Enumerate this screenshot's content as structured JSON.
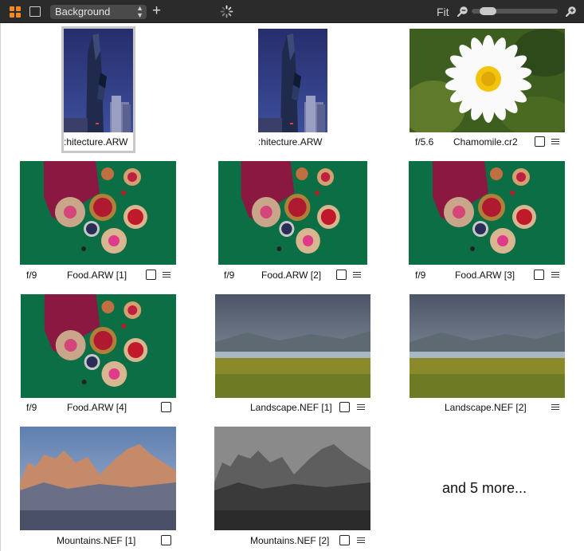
{
  "toolbar": {
    "preset_value": "Background",
    "fit_label": "Fit",
    "zoom_level": 0.12
  },
  "images": [
    {
      "name": ":hitecture.ARW",
      "aperture": "",
      "has_checkbox": false,
      "has_note": false,
      "selected": true,
      "thumb": "tower"
    },
    {
      "name": ":hitecture.ARW",
      "aperture": "",
      "has_checkbox": false,
      "has_note": false,
      "selected": false,
      "thumb": "tower"
    },
    {
      "name": "Chamomile.cr2",
      "aperture": "f/5.6",
      "has_checkbox": true,
      "has_note": true,
      "selected": false,
      "thumb": "daisy"
    },
    {
      "name": "Food.ARW [1]",
      "aperture": "f/9",
      "has_checkbox": true,
      "has_note": true,
      "selected": false,
      "thumb": "food"
    },
    {
      "name": "Food.ARW [2]",
      "aperture": "f/9",
      "has_checkbox": true,
      "has_note": true,
      "selected": false,
      "thumb": "food"
    },
    {
      "name": "Food.ARW [3]",
      "aperture": "f/9",
      "has_checkbox": true,
      "has_note": true,
      "selected": false,
      "thumb": "food"
    },
    {
      "name": "Food.ARW [4]",
      "aperture": "f/9",
      "has_checkbox": true,
      "has_note": false,
      "selected": false,
      "thumb": "food"
    },
    {
      "name": "Landscape.NEF [1]",
      "aperture": "",
      "has_checkbox": true,
      "has_note": true,
      "selected": false,
      "thumb": "landscape"
    },
    {
      "name": "Landscape.NEF [2]",
      "aperture": "",
      "has_checkbox": false,
      "has_note": true,
      "selected": false,
      "thumb": "landscape"
    },
    {
      "name": "Mountains.NEF [1]",
      "aperture": "",
      "has_checkbox": true,
      "has_note": false,
      "selected": false,
      "thumb": "mountains"
    },
    {
      "name": "Mountains.NEF [2]",
      "aperture": "",
      "has_checkbox": true,
      "has_note": true,
      "selected": false,
      "thumb": "mountains-bw"
    }
  ],
  "more_text": "and 5 more..."
}
